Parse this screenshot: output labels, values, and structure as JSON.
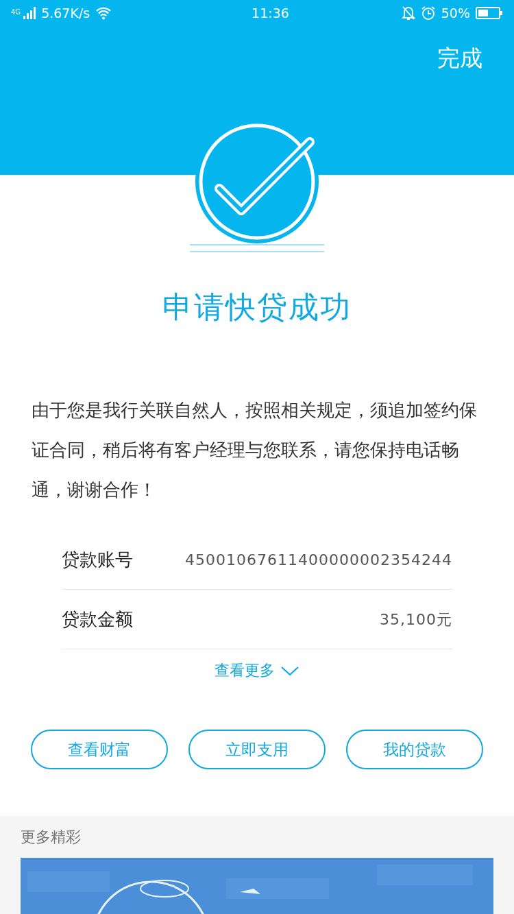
{
  "status_bar": {
    "network": "4G",
    "speed": "5.67K/s",
    "time": "11:36",
    "battery": "50%"
  },
  "header": {
    "action": "完成"
  },
  "result": {
    "title": "申请快贷成功",
    "message": "由于您是我行关联自然人，按照相关规定，须追加签约保证合同，稍后将有客户经理与您联系，请您保持电话畅通，谢谢合作！"
  },
  "details": [
    {
      "label": "贷款账号",
      "value": "45001067611400000002354244"
    },
    {
      "label": "贷款金额",
      "value": "35,100元"
    }
  ],
  "more_link": "查看更多",
  "buttons": [
    "查看财富",
    "立即支用",
    "我的贷款"
  ],
  "more_section": {
    "title": "更多精彩"
  }
}
